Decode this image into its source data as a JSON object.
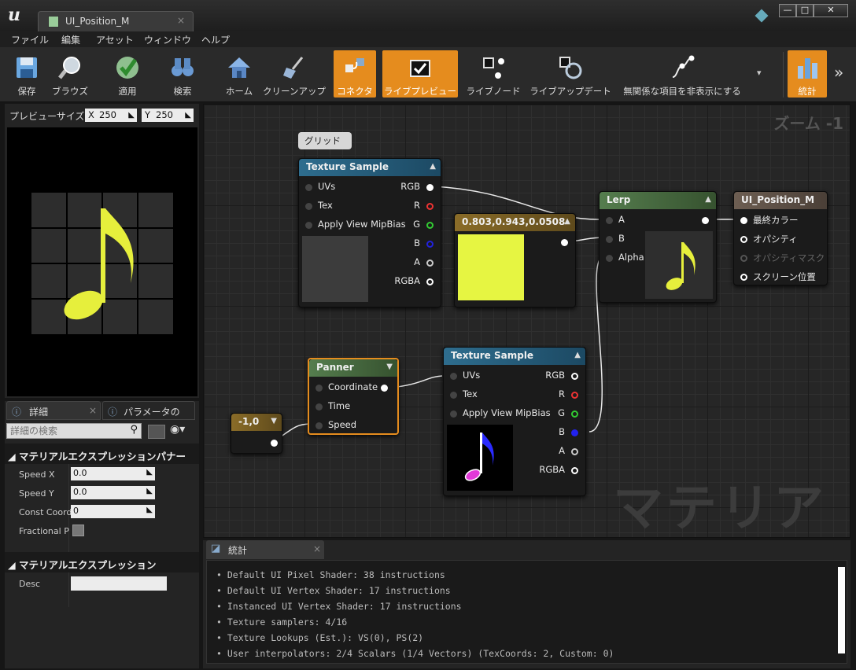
{
  "window": {
    "tab_title": "UI_Position_M",
    "tab_close": "×",
    "min": "—",
    "max": "□",
    "close": "✕"
  },
  "menu": [
    "ファイル",
    "編集",
    "アセット",
    "ウィンドウ",
    "ヘルプ"
  ],
  "toolbar": {
    "items": [
      "保存",
      "ブラウズ",
      "適用",
      "検索",
      "ホーム",
      "クリーンアップ",
      "コネクタ",
      "ライブプレビュー",
      "ライブノード",
      "ライブアップデート",
      "無関係な項目を非表示にする",
      "統計"
    ],
    "more": "»",
    "dropdown": "▾"
  },
  "preview": {
    "label": "プレビューサイズ",
    "x_label": "X",
    "x_value": "250",
    "y_label": "Y",
    "y_value": "250",
    "note_color": "#e6ef3c"
  },
  "details": {
    "tab1": "詳細",
    "tab2": "パラメータの",
    "search_placeholder": "詳細の検索",
    "section1": "◢ マテリアルエクスプレッションパナー",
    "props": [
      {
        "label": "Speed X",
        "value": "0.0"
      },
      {
        "label": "Speed Y",
        "value": "0.0"
      },
      {
        "label": "Const Coord",
        "value": "0"
      },
      {
        "label": "Fractional Pa",
        "value": ""
      }
    ],
    "section2": "◢ マテリアルエクスプレッション",
    "desc_label": "Desc"
  },
  "graph": {
    "zoom": "ズーム -1",
    "watermark": "マテリアル",
    "comment": "グリッド",
    "tex1": {
      "title": "Texture Sample",
      "inputs": [
        "UVs",
        "Tex",
        "Apply View MipBias"
      ],
      "outputs": [
        "RGB",
        "R",
        "G",
        "B",
        "A",
        "RGBA"
      ]
    },
    "const": {
      "title": "0.803,0.943,0.0508",
      "color": "#e6f542"
    },
    "lerp": {
      "title": "Lerp",
      "inputs": [
        "A",
        "B",
        "Alpha"
      ]
    },
    "result": {
      "title": "UI_Position_M",
      "pins": [
        "最終カラー",
        "オパシティ",
        "オパシティマスク",
        "スクリーン位置"
      ]
    },
    "panner": {
      "title": "Panner",
      "inputs": [
        "Coordinate",
        "Time",
        "Speed"
      ]
    },
    "vec2": {
      "title": "-1,0"
    },
    "tex2": {
      "title": "Texture Sample",
      "inputs": [
        "UVs",
        "Tex",
        "Apply View MipBias"
      ],
      "outputs": [
        "RGB",
        "R",
        "G",
        "B",
        "A",
        "RGBA"
      ]
    }
  },
  "stats": {
    "tab": "統計",
    "lines": [
      "• Default UI Pixel Shader: 38 instructions",
      "• Default UI Vertex Shader: 17 instructions",
      "• Instanced UI Vertex Shader: 17 instructions",
      "• Texture samplers: 4/16",
      "• Texture Lookups (Est.): VS(0), PS(2)",
      "• User interpolators: 2/4 Scalars (1/4 Vectors) (TexCoords: 2, Custom: 0)"
    ]
  }
}
